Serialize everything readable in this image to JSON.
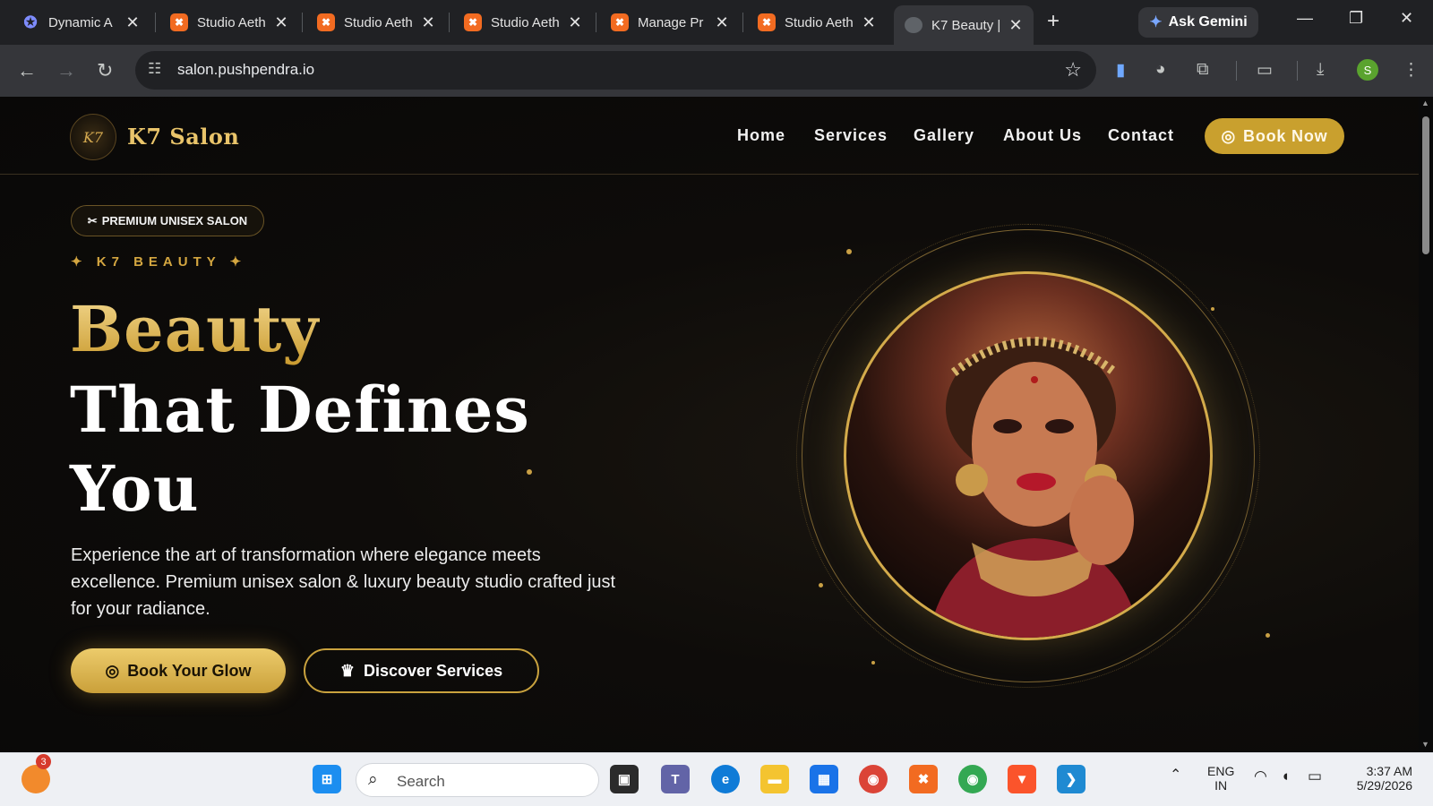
{
  "browser": {
    "tabs": [
      {
        "title": "Dynamic A",
        "icon": "dynamic-app-icon"
      },
      {
        "title": "Studio Aeth",
        "icon": "xampp-icon"
      },
      {
        "title": "Studio Aeth",
        "icon": "xampp-icon"
      },
      {
        "title": "Studio Aeth",
        "icon": "xampp-icon"
      },
      {
        "title": "Manage Pr",
        "icon": "xampp-icon"
      },
      {
        "title": "Studio Aeth",
        "icon": "xampp-icon"
      },
      {
        "title": "K7 Beauty |",
        "icon": "globe-icon",
        "active": true
      }
    ],
    "gemini_label": "Ask Gemini",
    "url": "salon.pushpendra.io",
    "profile_initial": "S"
  },
  "site": {
    "brand_mark": "K7",
    "brand": "K7 Salon",
    "nav": [
      "Home",
      "Services",
      "Gallery",
      "About Us",
      "Contact"
    ],
    "book_now": "Book Now",
    "badge": "PREMIUM UNISEX SALON",
    "kicker": "✦ K7 BEAUTY ✦",
    "headline": [
      "Beauty",
      "That Defines",
      "You"
    ],
    "description": "Experience the art of transformation where elegance meets excellence. Premium unisex salon & luxury beauty studio crafted just for your radiance.",
    "cta_primary": "Book Your Glow",
    "cta_secondary": "Discover Services",
    "colors": {
      "gold": "#c9a02e",
      "background": "#0e0c0a"
    }
  },
  "taskbar": {
    "search_label": "Search",
    "notification_count": "3",
    "lang_line1": "ENG",
    "lang_line2": "IN",
    "time": "3:37 AM",
    "date": "5/29/2026"
  }
}
